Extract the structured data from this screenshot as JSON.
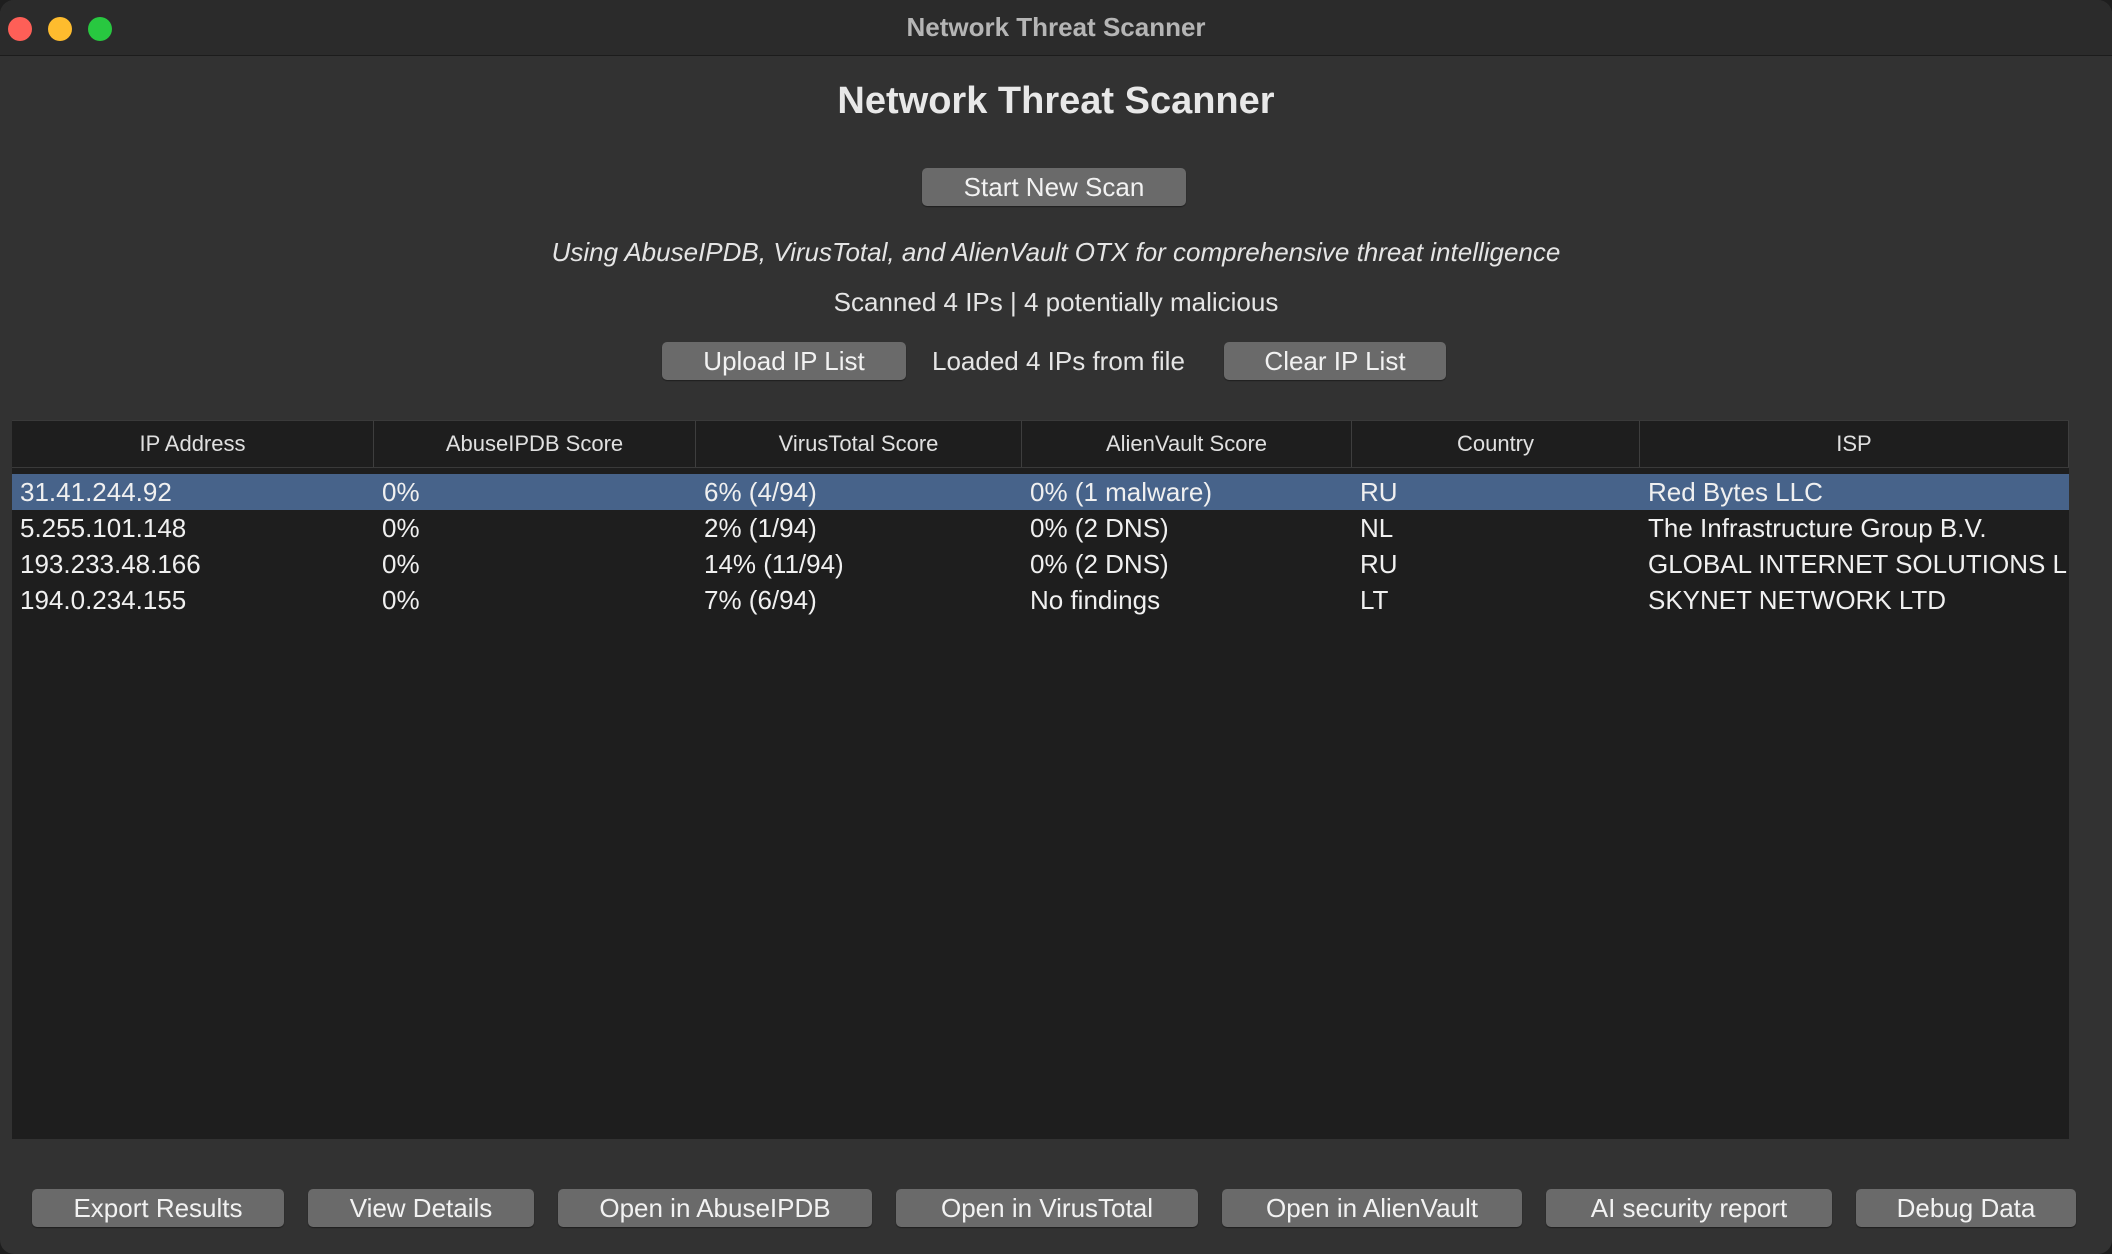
{
  "window": {
    "title": "Network Threat Scanner"
  },
  "header": {
    "heading": "Network Threat Scanner",
    "start_scan_label": "Start New Scan",
    "sources_text": "Using AbuseIPDB, VirusTotal, and AlienVault OTX for comprehensive threat intelligence",
    "summary_text": "Scanned 4 IPs | 4 potentially malicious",
    "upload_label": "Upload IP List",
    "loaded_text": "Loaded 4 IPs from file",
    "clear_label": "Clear IP List"
  },
  "table": {
    "columns": [
      "IP Address",
      "AbuseIPDB Score",
      "VirusTotal Score",
      "AlienVault Score",
      "Country",
      "ISP"
    ],
    "selected_row": 0,
    "rows": [
      [
        "31.41.244.92",
        "0%",
        "6% (4/94)",
        "0% (1 malware)",
        "RU",
        "Red Bytes LLC"
      ],
      [
        "5.255.101.148",
        "0%",
        "2% (1/94)",
        "0% (2 DNS)",
        "NL",
        "The Infrastructure Group B.V."
      ],
      [
        "193.233.48.166",
        "0%",
        "14% (11/94)",
        "0% (2 DNS)",
        "RU",
        "GLOBAL INTERNET SOLUTIONS L"
      ],
      [
        "194.0.234.155",
        "0%",
        "7% (6/94)",
        "No findings",
        "LT",
        "SKYNET NETWORK LTD"
      ]
    ]
  },
  "footer": {
    "buttons": [
      "Export Results",
      "View Details",
      "Open in AbuseIPDB",
      "Open in VirusTotal",
      "Open in AlienVault",
      "AI security report",
      "Debug Data"
    ]
  },
  "colors": {
    "selection": "#47638a",
    "button": "#6a6a6a",
    "window_bg": "#323232",
    "table_bg": "#1e1e1e"
  }
}
